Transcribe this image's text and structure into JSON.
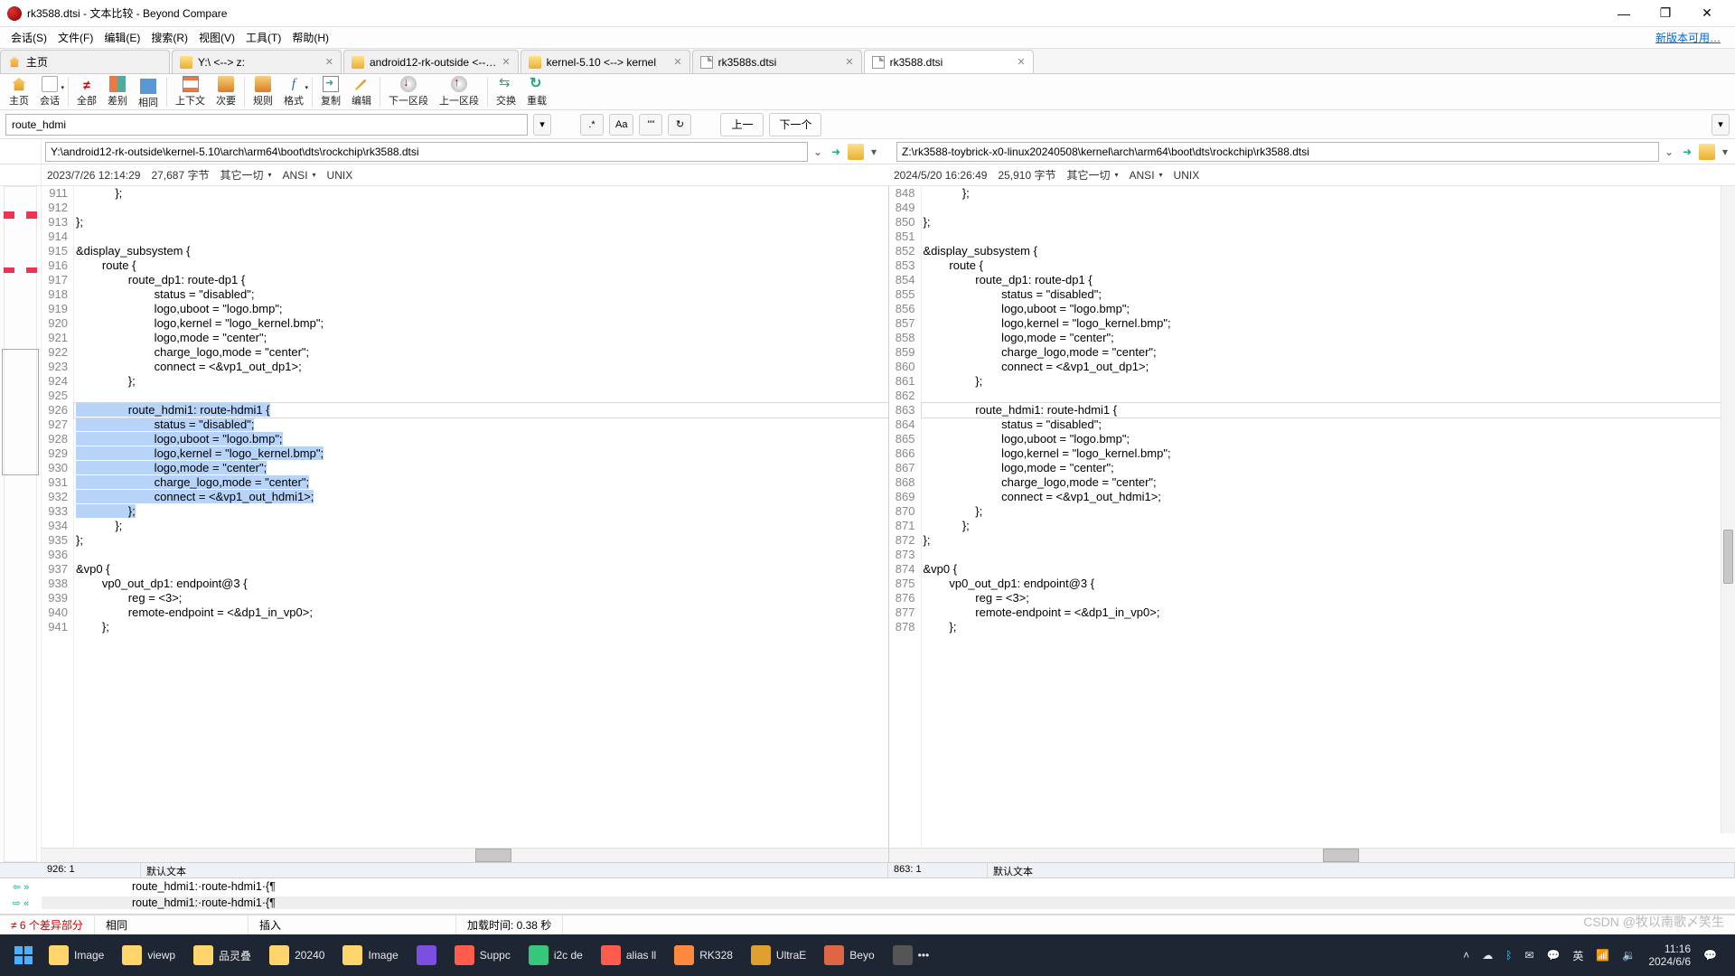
{
  "title": "rk3588.dtsi - 文本比较 - Beyond Compare",
  "menu": [
    "会话(S)",
    "文件(F)",
    "编辑(E)",
    "搜索(R)",
    "视图(V)",
    "工具(T)",
    "帮助(H)"
  ],
  "menu_right": "新版本可用…",
  "tabs": [
    {
      "label": "主页",
      "icon": "home"
    },
    {
      "label": "Y:\\ <--> z:",
      "icon": "folder"
    },
    {
      "label": "android12-rk-outside <--…",
      "icon": "folder"
    },
    {
      "label": "kernel-5.10 <--> kernel",
      "icon": "folder"
    },
    {
      "label": "rk3588s.dtsi",
      "icon": "file"
    },
    {
      "label": "rk3588.dtsi",
      "icon": "file",
      "active": true
    }
  ],
  "tool": {
    "home": "主页",
    "session": "会话",
    "all": "全部",
    "diff": "差别",
    "same": "相同",
    "ctx": "上下文",
    "minor": "次要",
    "rules": "规则",
    "fmt": "格式",
    "copy": "复制",
    "edit": "编辑",
    "nextsec": "下一区段",
    "prevsec": "上一区段",
    "swap": "交换",
    "reload": "重载"
  },
  "all_sym": "≠",
  "fmt_sym": "f",
  "search_val": "route_hdmi",
  "sopt": {
    "regex": ".*",
    "case": "Aa",
    "word": "\"\"",
    "refresh": "↻"
  },
  "nav": {
    "prev": "上一",
    "next": "下一个"
  },
  "left": {
    "path": "Y:\\android12-rk-outside\\kernel-5.10\\arch\\arm64\\boot\\dts\\rockchip\\rk3588.dtsi",
    "date": "2023/7/26 12:14:29",
    "size": "27,687 字节",
    "filter": "其它一切",
    "enc": "ANSI",
    "eol": "UNIX",
    "nums": [
      "911",
      "912",
      "913",
      "914",
      "915",
      "916",
      "917",
      "918",
      "919",
      "920",
      "921",
      "922",
      "923",
      "924",
      "925",
      "926",
      "927",
      "928",
      "929",
      "930",
      "931",
      "932",
      "933",
      "934",
      "935",
      "936",
      "937",
      "938",
      "939",
      "940",
      "941"
    ],
    "lines": [
      "            };",
      "",
      "};",
      "",
      "&display_subsystem {",
      "        route {",
      "                route_dp1: route-dp1 {",
      "                        status = \"disabled\";",
      "                        logo,uboot = \"logo.bmp\";",
      "                        logo,kernel = \"logo_kernel.bmp\";",
      "                        logo,mode = \"center\";",
      "                        charge_logo,mode = \"center\";",
      "                        connect = <&vp1_out_dp1>;",
      "                };",
      "",
      "                route_hdmi1: route-hdmi1 {",
      "                        status = \"disabled\";",
      "                        logo,uboot = \"logo.bmp\";",
      "                        logo,kernel = \"logo_kernel.bmp\";",
      "                        logo,mode = \"center\";",
      "                        charge_logo,mode = \"center\";",
      "                        connect = <&vp1_out_hdmi1>;",
      "                };",
      "            };",
      "};",
      "",
      "&vp0 {",
      "        vp0_out_dp1: endpoint@3 {",
      "                reg = <3>;",
      "                remote-endpoint = <&dp1_in_vp0>;",
      "        };"
    ],
    "pos": "926: 1",
    "mode": "默认文本"
  },
  "right": {
    "path": "Z:\\rk3588-toybrick-x0-linux20240508\\kernel\\arch\\arm64\\boot\\dts\\rockchip\\rk3588.dtsi",
    "date": "2024/5/20 16:26:49",
    "size": "25,910 字节",
    "filter": "其它一切",
    "enc": "ANSI",
    "eol": "UNIX",
    "nums": [
      "848",
      "849",
      "850",
      "851",
      "852",
      "853",
      "854",
      "855",
      "856",
      "857",
      "858",
      "859",
      "860",
      "861",
      "862",
      "863",
      "864",
      "865",
      "866",
      "867",
      "868",
      "869",
      "870",
      "871",
      "872",
      "873",
      "874",
      "875",
      "876",
      "877",
      "878"
    ],
    "lines": [
      "            };",
      "",
      "};",
      "",
      "&display_subsystem {",
      "        route {",
      "                route_dp1: route-dp1 {",
      "                        status = \"disabled\";",
      "                        logo,uboot = \"logo.bmp\";",
      "                        logo,kernel = \"logo_kernel.bmp\";",
      "                        logo,mode = \"center\";",
      "                        charge_logo,mode = \"center\";",
      "                        connect = <&vp1_out_dp1>;",
      "                };",
      "",
      "                route_hdmi1: route-hdmi1 {",
      "                        status = \"disabled\";",
      "                        logo,uboot = \"logo.bmp\";",
      "                        logo,kernel = \"logo_kernel.bmp\";",
      "                        logo,mode = \"center\";",
      "                        charge_logo,mode = \"center\";",
      "                        connect = <&vp1_out_hdmi1>;",
      "                };",
      "            };",
      "};",
      "",
      "&vp0 {",
      "        vp0_out_dp1: endpoint@3 {",
      "                reg = <3>;",
      "                remote-endpoint = <&dp1_in_vp0>;",
      "        };"
    ],
    "pos": "863: 1",
    "mode": "默认文本"
  },
  "detail": {
    "l1": "route_hdmi1:·route-hdmi1·{¶",
    "l2": "route_hdmi1:·route-hdmi1·{¶"
  },
  "status": {
    "diff": "≠ 6 个差异部分",
    "same": "相同",
    "ins": "插入",
    "load": "加载时间: 0.38 秒"
  },
  "task": {
    "items": [
      "Image",
      "viewp",
      "品灵叠",
      "20240",
      "Image",
      "",
      "Suppc",
      "i2c de",
      "alias ll",
      "RK328",
      "UltraE",
      "Beyo",
      "•••"
    ],
    "tray": {
      "ime": "英",
      "time": "11:16",
      "date": "2024/6/6"
    }
  },
  "watermark": "CSDN @牧以南歌〆笑生"
}
